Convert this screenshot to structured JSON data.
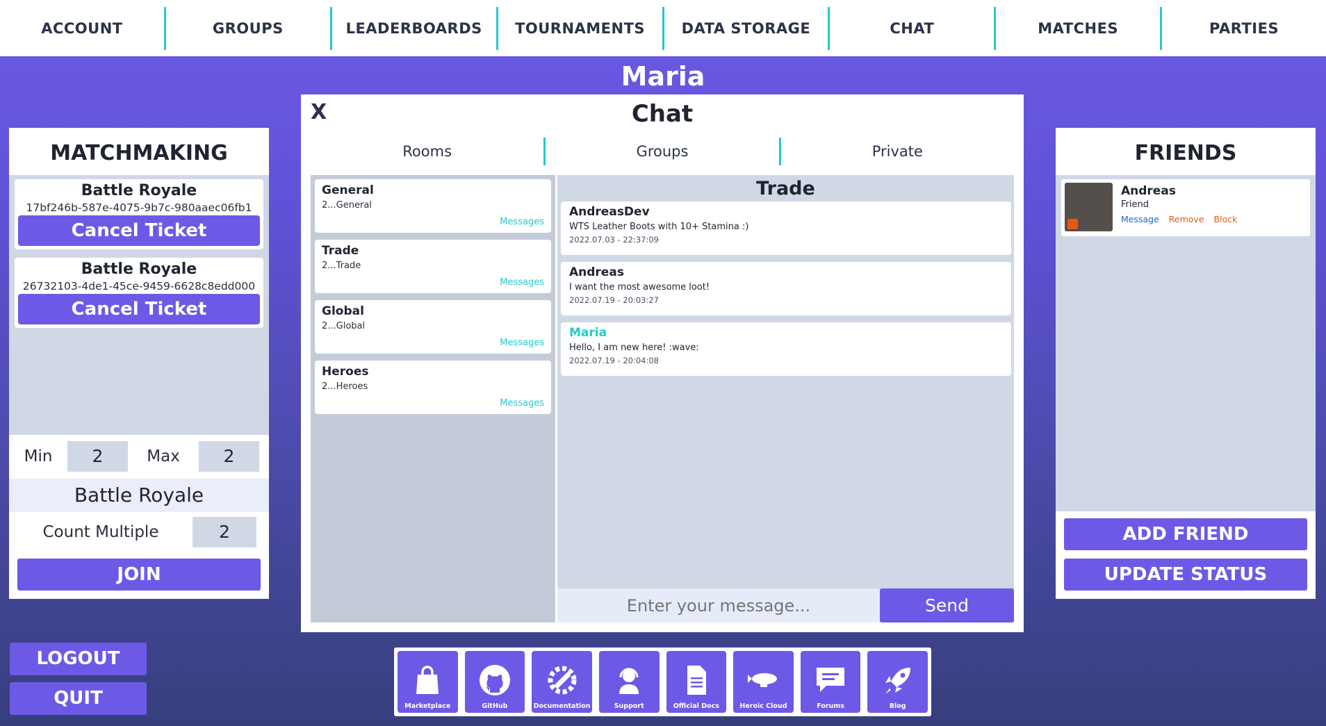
{
  "nav": {
    "items": [
      "ACCOUNT",
      "GROUPS",
      "LEADERBOARDS",
      "TOURNAMENTS",
      "DATA STORAGE",
      "CHAT",
      "MATCHES",
      "PARTIES"
    ]
  },
  "user": {
    "name": "Maria"
  },
  "matchmaking": {
    "title": "MATCHMAKING",
    "tickets": [
      {
        "mode": "Battle Royale",
        "id": "17bf246b-587e-4075-9b7c-980aaec06fb1",
        "cancel_label": "Cancel Ticket"
      },
      {
        "mode": "Battle Royale",
        "id": "26732103-4de1-45ce-9459-6628c8edd000",
        "cancel_label": "Cancel Ticket"
      }
    ],
    "min_label": "Min",
    "min_value": "2",
    "max_label": "Max",
    "max_value": "2",
    "mode_selected": "Battle Royale",
    "count_multiple_label": "Count Multiple",
    "count_multiple_value": "2",
    "join_label": "JOIN"
  },
  "chat": {
    "close_label": "X",
    "title": "Chat",
    "tabs": [
      "Rooms",
      "Groups",
      "Private"
    ],
    "rooms": [
      {
        "name": "General",
        "sub": "2...General",
        "link": "Messages"
      },
      {
        "name": "Trade",
        "sub": "2...Trade",
        "link": "Messages"
      },
      {
        "name": "Global",
        "sub": "2...Global",
        "link": "Messages"
      },
      {
        "name": "Heroes",
        "sub": "2...Heroes",
        "link": "Messages"
      }
    ],
    "active_room": "Trade",
    "messages": [
      {
        "author": "AndreasDev",
        "text": "WTS Leather Boots with 10+ Stamina :)",
        "time": "2022.07.03 - 22:37:09"
      },
      {
        "author": "Andreas",
        "text": "I want the most awesome loot!",
        "time": "2022.07.19 - 20:03:27"
      },
      {
        "author": "Maria",
        "text": "Hello, I am new here! :wave:",
        "time": "2022.07.19 - 20:04:08"
      }
    ],
    "input_placeholder": "Enter your message...",
    "send_label": "Send"
  },
  "friends": {
    "title": "FRIENDS",
    "list": [
      {
        "name": "Andreas",
        "relation": "Friend",
        "actions": {
          "message": "Message",
          "remove": "Remove",
          "block": "Block"
        }
      }
    ],
    "add_label": "ADD FRIEND",
    "status_label": "UPDATE STATUS"
  },
  "side": {
    "logout_label": "LOGOUT",
    "quit_label": "QUIT"
  },
  "dock": {
    "items": [
      {
        "label": "Marketplace",
        "icon": "shopping-bag-icon"
      },
      {
        "label": "GitHub",
        "icon": "github-icon"
      },
      {
        "label": "Documentation",
        "icon": "wrench-gear-icon"
      },
      {
        "label": "Support",
        "icon": "headset-icon"
      },
      {
        "label": "Official Docs",
        "icon": "document-icon"
      },
      {
        "label": "Heroic Cloud",
        "icon": "blimp-icon"
      },
      {
        "label": "Forums",
        "icon": "speech-bubble-icon"
      },
      {
        "label": "Blog",
        "icon": "rocket-icon"
      }
    ]
  },
  "colors": {
    "accent": "#6c5ae6",
    "divider": "#23c9cc",
    "panel_bg": "#d0d8e6",
    "status_orange": "#e25a12",
    "link_blue": "#1a66d6"
  }
}
